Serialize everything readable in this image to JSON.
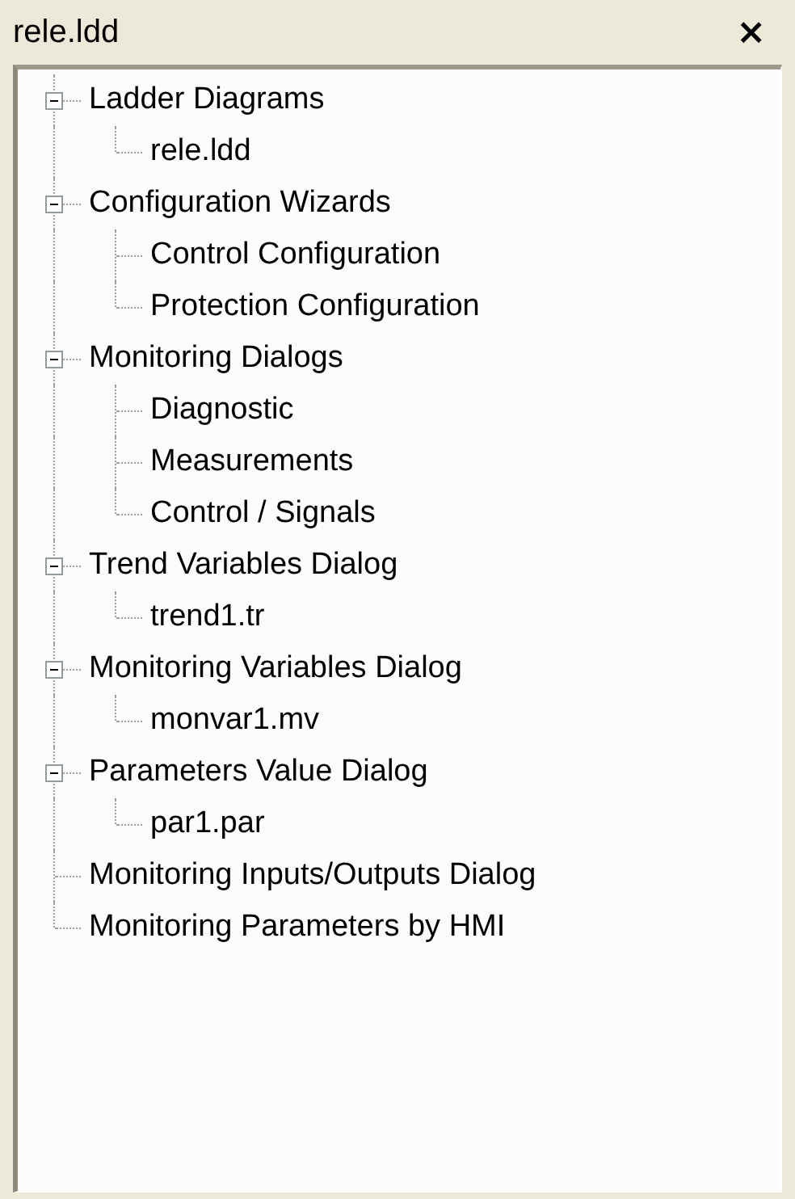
{
  "window": {
    "title": "rele.ldd",
    "close": "×"
  },
  "tree": [
    {
      "label": "Ladder Diagrams",
      "expanded": true,
      "children": [
        {
          "label": "rele.ldd"
        }
      ]
    },
    {
      "label": "Configuration Wizards",
      "expanded": true,
      "children": [
        {
          "label": "Control Configuration"
        },
        {
          "label": "Protection Configuration"
        }
      ]
    },
    {
      "label": "Monitoring Dialogs",
      "expanded": true,
      "children": [
        {
          "label": "Diagnostic"
        },
        {
          "label": "Measurements"
        },
        {
          "label": "Control / Signals"
        }
      ]
    },
    {
      "label": "Trend Variables Dialog",
      "expanded": true,
      "children": [
        {
          "label": "trend1.tr"
        }
      ]
    },
    {
      "label": "Monitoring Variables Dialog",
      "expanded": true,
      "children": [
        {
          "label": "monvar1.mv"
        }
      ]
    },
    {
      "label": "Parameters Value Dialog",
      "expanded": true,
      "children": [
        {
          "label": "par1.par"
        }
      ]
    },
    {
      "label": "Monitoring Inputs/Outputs Dialog"
    },
    {
      "label": "Monitoring Parameters by HMI"
    }
  ]
}
